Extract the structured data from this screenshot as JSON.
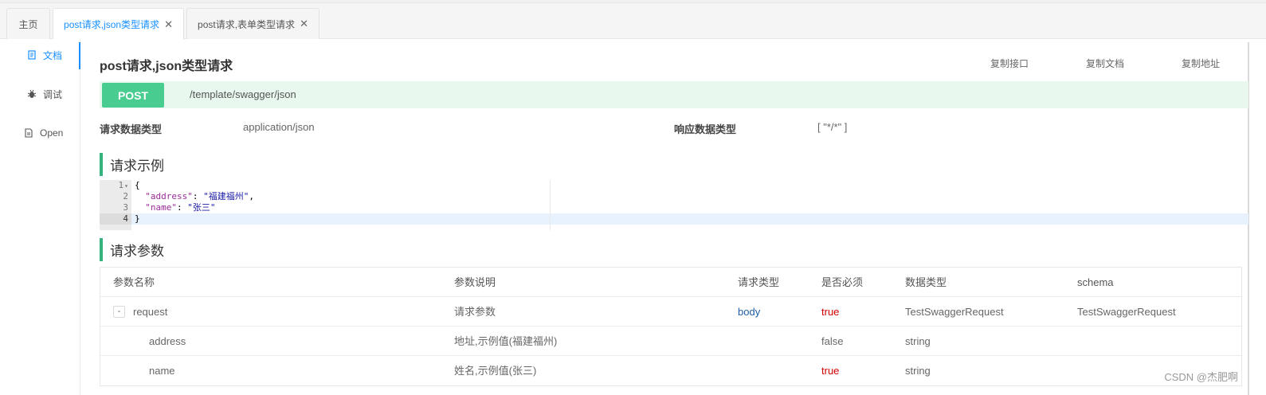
{
  "tabs": [
    {
      "label": "主页",
      "closable": false,
      "active": false
    },
    {
      "label": "post请求,json类型请求",
      "closable": true,
      "active": true
    },
    {
      "label": "post请求,表单类型请求",
      "closable": true,
      "active": false
    }
  ],
  "close_glyph": "✕",
  "leftnav": [
    {
      "label": "文档",
      "icon": "document-icon",
      "active": true
    },
    {
      "label": "调试",
      "icon": "bug-icon",
      "active": false
    },
    {
      "label": "Open",
      "icon": "file-icon",
      "active": false
    }
  ],
  "api": {
    "title": "post请求,json类型请求",
    "actions": [
      "复制接口",
      "复制文档",
      "复制地址"
    ],
    "method": "POST",
    "path": "/template/swagger/json",
    "request_type_label": "请求数据类型",
    "request_type_value": "application/json",
    "response_type_label": "响应数据类型",
    "response_type_value": "[ \"*/*\" ]"
  },
  "example": {
    "heading": "请求示例",
    "line_numbers": [
      "1",
      "2",
      "3",
      "4"
    ],
    "fold_marker": "▾",
    "open_brace": "{",
    "close_brace": "}",
    "lines": [
      {
        "key": "\"address\"",
        "sep": ": ",
        "value": "\"福建福州\"",
        "tail": ","
      },
      {
        "key": "\"name\"",
        "sep": ": ",
        "value": "\"张三\"",
        "tail": ""
      }
    ]
  },
  "params": {
    "heading": "请求参数",
    "headers": [
      "参数名称",
      "参数说明",
      "请求类型",
      "是否必须",
      "数据类型",
      "schema"
    ],
    "rows": [
      {
        "toggle": "-",
        "name": "request",
        "desc": "请求参数",
        "in": "body",
        "required": "true",
        "type": "TestSwaggerRequest",
        "schema": "TestSwaggerRequest"
      },
      {
        "toggle": "",
        "name": "address",
        "desc": "地址,示例值(福建福州)",
        "in": "",
        "required": "false",
        "type": "string",
        "schema": ""
      },
      {
        "toggle": "",
        "name": "name",
        "desc": "姓名,示例值(张三)",
        "in": "",
        "required": "true",
        "type": "string",
        "schema": ""
      }
    ]
  },
  "watermark": "CSDN @杰肥啊",
  "colors": {
    "accent": "#1890ff",
    "post": "#49cc90",
    "section_bar": "#35b37e",
    "required_true": "#d00000",
    "in_body": "#1f5fa8"
  }
}
